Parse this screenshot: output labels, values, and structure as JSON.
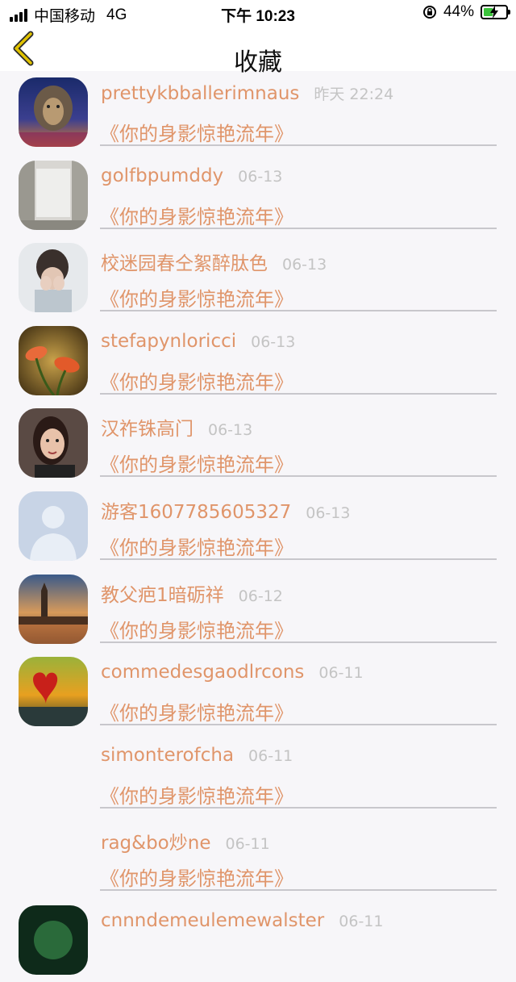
{
  "status_bar": {
    "carrier": "中国移动",
    "network": "4G",
    "time": "下午 10:23",
    "battery": "44%",
    "battery_level": 0.44,
    "battery_color": "#3cc43c"
  },
  "nav": {
    "title": "收藏",
    "back_icon": "chevron-left-icon",
    "accent_color": "#e0c200"
  },
  "list": {
    "items": [
      {
        "name": "prettykbballerimnaus",
        "time": "昨天 22:24",
        "title": "《你的身影惊艳流年》",
        "avatar": "lion"
      },
      {
        "name": "golfbpumddy",
        "time": "06-13",
        "title": "《你的身影惊艳流年》",
        "avatar": "room"
      },
      {
        "name": "校迷园春仝絮醉肽色",
        "time": "06-13",
        "title": "《你的身影惊艳流年》",
        "avatar": "girl-hands"
      },
      {
        "name": "stefapynloricci",
        "time": "06-13",
        "title": "《你的身影惊艳流年》",
        "avatar": "flower"
      },
      {
        "name": "汉祚铢高门",
        "time": "06-13",
        "title": "《你的身影惊艳流年》",
        "avatar": "woman"
      },
      {
        "name": "游客1607785605327",
        "time": "06-13",
        "title": "《你的身影惊艳流年》",
        "avatar": "default-user"
      },
      {
        "name": "教父疤1暗砺祥",
        "time": "06-12",
        "title": "《你的身影惊艳流年》",
        "avatar": "london"
      },
      {
        "name": "commedesgaodlrcons",
        "time": "06-11",
        "title": "《你的身影惊艳流年》",
        "avatar": "heart-sunset"
      },
      {
        "name": "simonterofcha",
        "time": "06-11",
        "title": "《你的身影惊艳流年》",
        "avatar": "none"
      },
      {
        "name": "rag&bo炒ne",
        "time": "06-11",
        "title": "《你的身影惊艳流年》",
        "avatar": "none"
      },
      {
        "name": "cnnndemeulemewalster",
        "time": "06-11",
        "title": "",
        "avatar": "dark-green"
      }
    ]
  },
  "colors": {
    "name": "#e0956a",
    "time": "#c4c4c4",
    "divider": "#c8c7cc",
    "background": "#f7f6f9"
  }
}
